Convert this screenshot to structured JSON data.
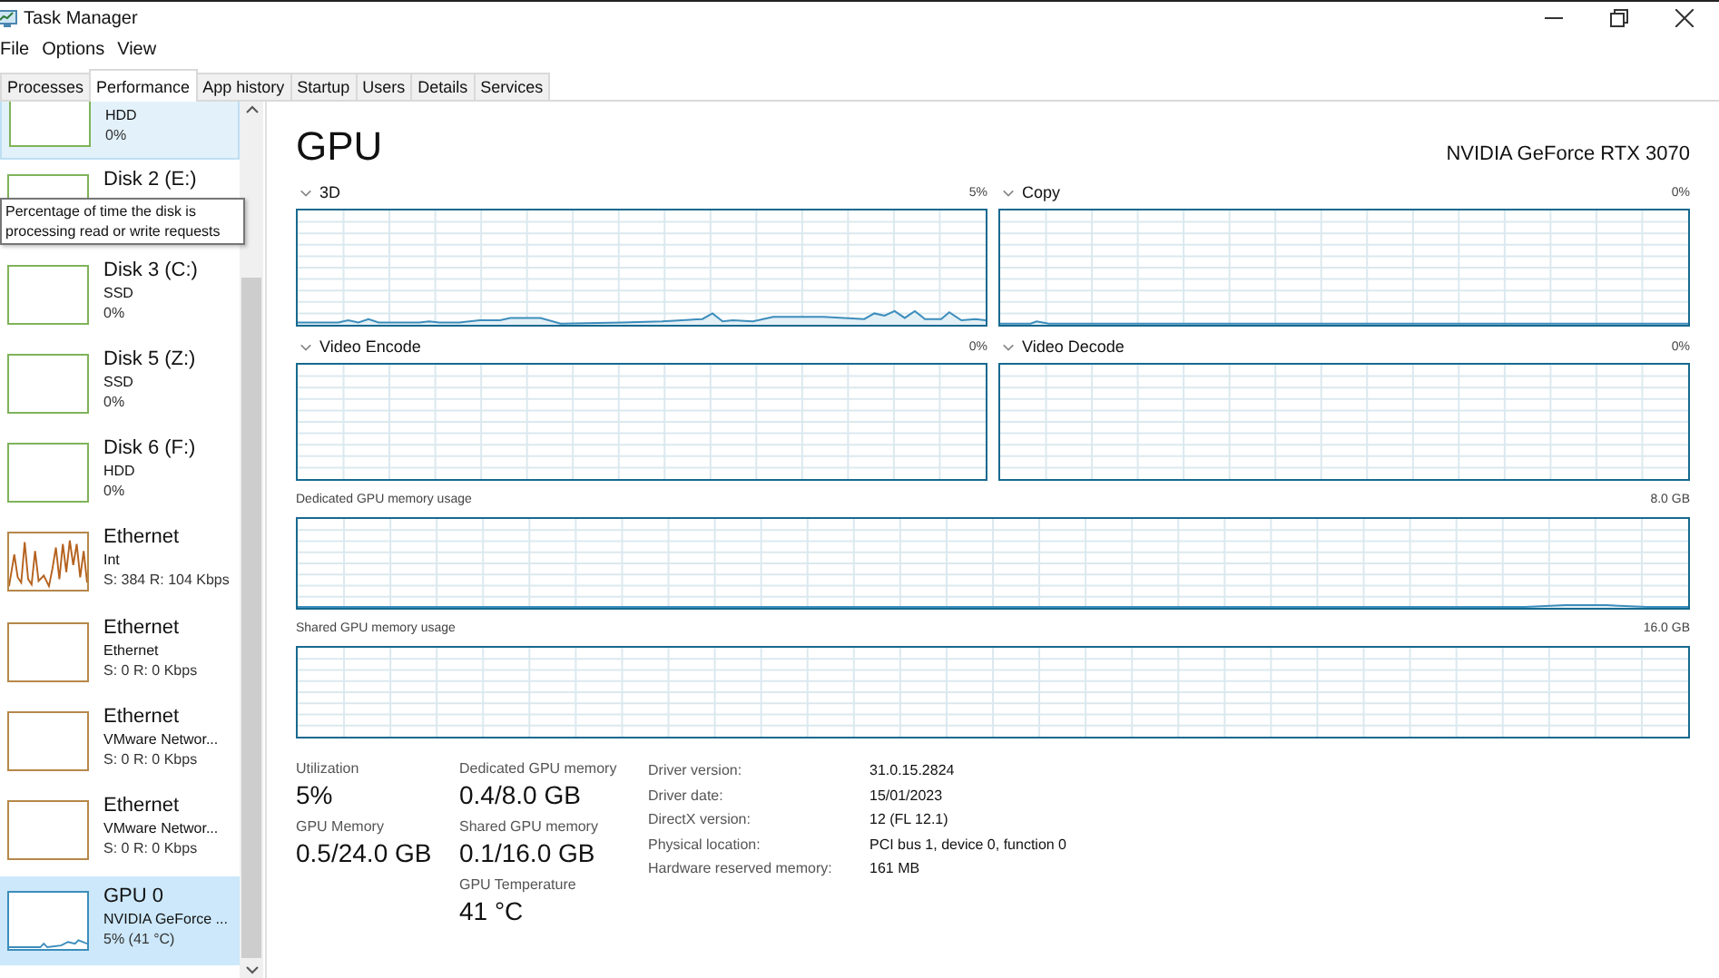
{
  "window": {
    "title": "Task Manager"
  },
  "menu": [
    "File",
    "Options",
    "View"
  ],
  "tabs": [
    {
      "label": "Processes",
      "selected": false
    },
    {
      "label": "Performance",
      "selected": true
    },
    {
      "label": "App history",
      "selected": false
    },
    {
      "label": "Startup",
      "selected": false
    },
    {
      "label": "Users",
      "selected": false
    },
    {
      "label": "Details",
      "selected": false
    },
    {
      "label": "Services",
      "selected": false
    }
  ],
  "sidebar": {
    "items": [
      {
        "kind": "disk",
        "subtitle": "HDD",
        "value": "0%",
        "hover": true,
        "selected": false
      },
      {
        "kind": "disk",
        "title": "Disk 2 (E:)",
        "hover": false,
        "selected": false
      },
      {
        "kind": "disk",
        "title": "Disk 3 (C:)",
        "subtitle": "SSD",
        "value": "0%",
        "hover": false,
        "selected": false
      },
      {
        "kind": "disk",
        "title": "Disk 5 (Z:)",
        "subtitle": "SSD",
        "value": "0%",
        "hover": false,
        "selected": false
      },
      {
        "kind": "disk",
        "title": "Disk 6 (F:)",
        "subtitle": "HDD",
        "value": "0%",
        "hover": false,
        "selected": false
      },
      {
        "kind": "ethernet-busy",
        "title": "Ethernet",
        "subtitle": "Int",
        "value": "S: 384 R: 104 Kbps",
        "hover": false,
        "selected": false
      },
      {
        "kind": "ethernet",
        "title": "Ethernet",
        "subtitle": "Ethernet",
        "value": "S: 0 R: 0 Kbps",
        "hover": false,
        "selected": false
      },
      {
        "kind": "ethernet",
        "title": "Ethernet",
        "subtitle": "VMware Networ...",
        "value": "S: 0 R: 0 Kbps",
        "hover": false,
        "selected": false
      },
      {
        "kind": "ethernet",
        "title": "Ethernet",
        "subtitle": "VMware Networ...",
        "value": "S: 0 R: 0 Kbps",
        "hover": false,
        "selected": false
      },
      {
        "kind": "gpu",
        "title": "GPU 0",
        "subtitle": "NVIDIA GeForce ...",
        "value": "5% (41 °C)",
        "hover": false,
        "selected": true
      }
    ]
  },
  "tooltip": "Percentage of time the disk is processing read or write requests",
  "panel": {
    "title": "GPU",
    "device": "NVIDIA GeForce RTX 3070",
    "graphs": [
      {
        "label": "3D",
        "value": "5%",
        "kind": "busy"
      },
      {
        "label": "Copy",
        "value": "0%",
        "kind": "blip"
      },
      {
        "label": "Video Encode",
        "value": "0%",
        "kind": "flat"
      },
      {
        "label": "Video Decode",
        "value": "0%",
        "kind": "flat"
      }
    ],
    "memory_graphs": [
      {
        "label": "Dedicated GPU memory usage",
        "value": "8.0 GB",
        "kind": "tail"
      },
      {
        "label": "Shared GPU memory usage",
        "value": "16.0 GB",
        "kind": "flat"
      }
    ],
    "stat_columns": [
      [
        {
          "label": "Utilization",
          "value": "5%"
        },
        {
          "label": "GPU Memory",
          "value": "0.5/24.0 GB"
        }
      ],
      [
        {
          "label": "Dedicated GPU memory",
          "value": "0.4/8.0 GB"
        },
        {
          "label": "Shared GPU memory",
          "value": "0.1/16.0 GB"
        },
        {
          "label": "GPU Temperature",
          "value": "41 °C"
        }
      ]
    ],
    "details": [
      {
        "label": "Driver version:",
        "value": "31.0.15.2824"
      },
      {
        "label": "Driver date:",
        "value": "15/01/2023"
      },
      {
        "label": "DirectX version:",
        "value": "12 (FL 12.1)"
      },
      {
        "label": "Physical location:",
        "value": "PCI bus 1, device 0, function 0"
      },
      {
        "label": "Hardware reserved memory:",
        "value": "161 MB"
      }
    ]
  }
}
